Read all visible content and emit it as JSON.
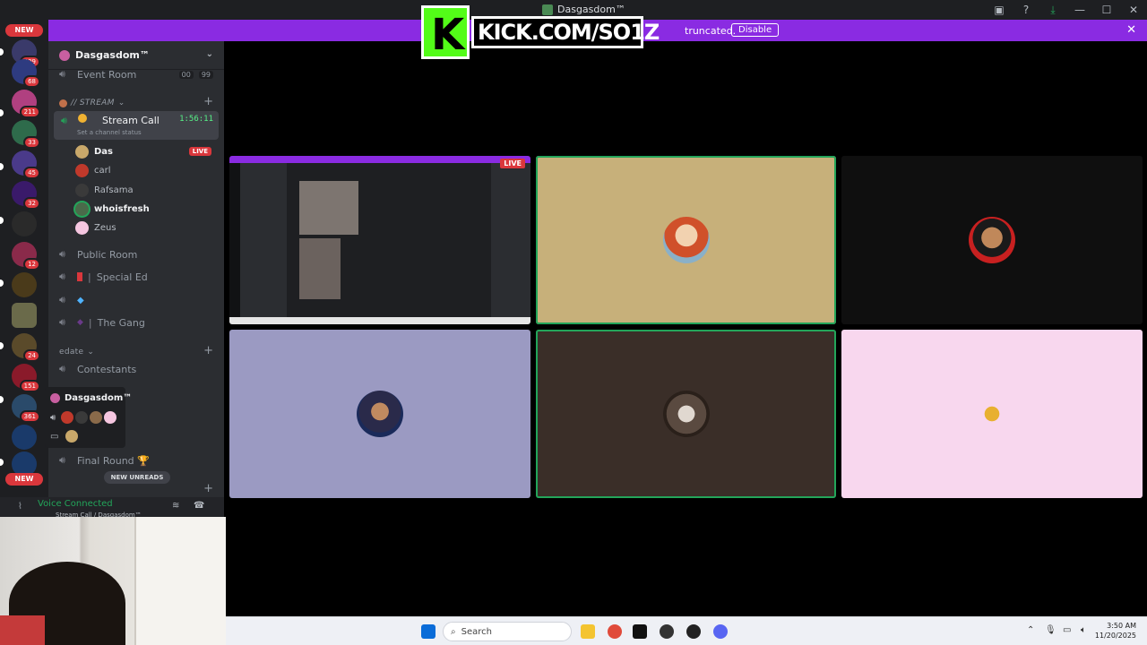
{
  "window": {
    "title": "Dasgasdom™"
  },
  "banner": {
    "message": "truncated.",
    "disable_label": "Disable"
  },
  "overlay": {
    "kick_url": "KICK.COM/SO1Z"
  },
  "servers": [
    {
      "badge": "409"
    },
    {
      "badge": "68"
    },
    {
      "badge": "211"
    },
    {
      "badge": "33"
    },
    {
      "badge": "45"
    },
    {
      "badge": "32"
    },
    {
      "badge": ""
    },
    {
      "badge": "12"
    },
    {
      "badge": ""
    },
    {
      "badge": ""
    },
    {
      "badge": "24"
    },
    {
      "badge": "151"
    },
    {
      "badge": "361"
    },
    {
      "badge": ""
    },
    {
      "badge": ""
    }
  ],
  "server_pills": {
    "top": "NEW",
    "bottom": "NEW"
  },
  "guild": {
    "name": "Dasgasdom™"
  },
  "channels": {
    "event_room": {
      "name": "Event Room",
      "count_a": "00",
      "count_b": "99"
    },
    "stream_category": "// STREAM",
    "stream_call": {
      "name": "Stream Call",
      "time": "1:56:11",
      "status": "Set a channel status"
    },
    "members": [
      {
        "name": "Das",
        "live": "LIVE"
      },
      {
        "name": "carl"
      },
      {
        "name": "Rafsama"
      },
      {
        "name": "whoisfresh"
      },
      {
        "name": "Zeus"
      }
    ],
    "public_room": "Public Room",
    "special_ed": "Special Ed",
    "the_gang": "The Gang",
    "edate_category": "edate",
    "contestants": "Contestants",
    "final_round": "Final Round 🏆"
  },
  "hover_card": {
    "name": "Dasgasdom™"
  },
  "new_unreads": "NEW UNREADS",
  "voice": {
    "connected": "Voice Connected",
    "location": "Stream Call / Dasgasdom™"
  },
  "stage": {
    "live_tag": "LIVE"
  },
  "taskbar": {
    "search_placeholder": "Search",
    "time": "3:50 AM",
    "date": "11/20/2025"
  },
  "colors": {
    "accent": "#8a2be2",
    "discord_green": "#23a55a",
    "kick_green": "#53fc18",
    "live_red": "#da373c"
  }
}
